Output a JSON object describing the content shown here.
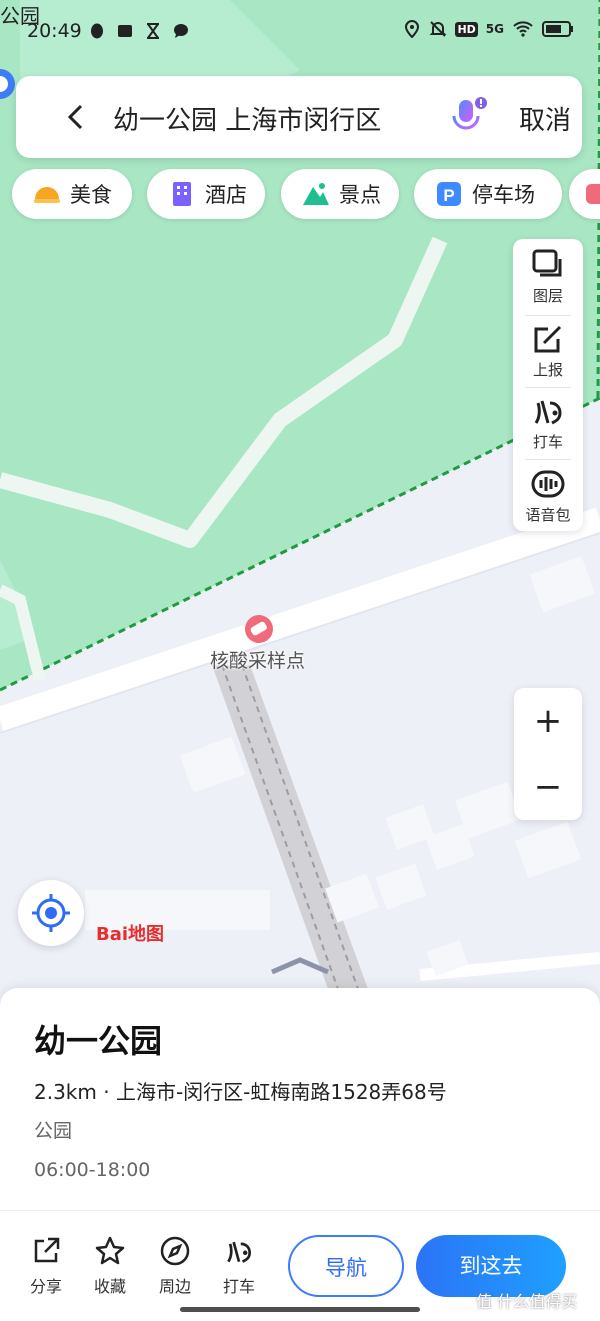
{
  "status_bar": {
    "time": "20:49",
    "corner_text": "公园",
    "left_icons": [
      "qq-icon",
      "app-badge-icon",
      "hourglass-icon",
      "chat-icon"
    ],
    "right_icons": [
      "location-icon",
      "mute-bell-icon",
      "hd-icon",
      "5g-signal-icon",
      "wifi-icon",
      "battery-icon"
    ],
    "hd": "HD",
    "net": "5G"
  },
  "search": {
    "query": "幼一公园 上海市闵行区",
    "cancel_label": "取消"
  },
  "categories": [
    {
      "label": "美食",
      "icon": "food-icon",
      "color": "#f5a623"
    },
    {
      "label": "酒店",
      "icon": "hotel-icon",
      "color": "#7b61ff"
    },
    {
      "label": "景点",
      "icon": "scenic-icon",
      "color": "#1fbf8f"
    },
    {
      "label": "停车场",
      "icon": "parking-icon",
      "color": "#3d8bff"
    }
  ],
  "map_tools": [
    {
      "label": "图层",
      "icon": "layers-icon"
    },
    {
      "label": "上报",
      "icon": "report-edit-icon"
    },
    {
      "label": "打车",
      "icon": "taxi-icon"
    },
    {
      "label": "语音包",
      "icon": "voice-pack-icon"
    }
  ],
  "zoom": {
    "in": "+",
    "out": "−"
  },
  "map": {
    "poi_label": "核酸采样点",
    "logo_text": "Bai地图"
  },
  "place": {
    "name": "幼一公园",
    "address": "2.3km · 上海市-闵行区-虹梅南路1528弄68号",
    "category": "公园",
    "hours": "06:00-18:00"
  },
  "actions": [
    {
      "label": "分享",
      "icon": "share-icon"
    },
    {
      "label": "收藏",
      "icon": "star-icon"
    },
    {
      "label": "周边",
      "icon": "compass-icon"
    },
    {
      "label": "打车",
      "icon": "taxi-icon"
    }
  ],
  "buttons": {
    "navigate": "导航",
    "go_here": "到这去"
  },
  "watermark": "值 什么值得买",
  "colors": {
    "park": "#a8e6c4",
    "accent": "#2f6cf5",
    "boundary": "#1e9b3e"
  }
}
